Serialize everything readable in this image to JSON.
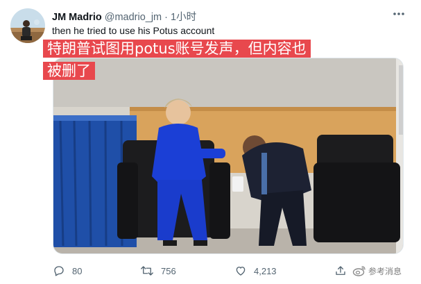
{
  "author": {
    "name": "JM Madrio",
    "handle": "@madrio_jm",
    "separator": "·",
    "time": "1小时"
  },
  "tweet": {
    "text": "then he tried to use his Potus account"
  },
  "caption_overlay": {
    "line1": "特朗普试图用potus账号发声，但内容也",
    "line2": "被删了"
  },
  "media": {
    "description_icon": "photo"
  },
  "actions": {
    "reply_count": "80",
    "retweet_count": "756",
    "like_count": "4,213"
  },
  "watermark": {
    "text": "参考消息"
  },
  "colors": {
    "caption_bg": "#e8484d",
    "secondary_text": "#536471"
  }
}
